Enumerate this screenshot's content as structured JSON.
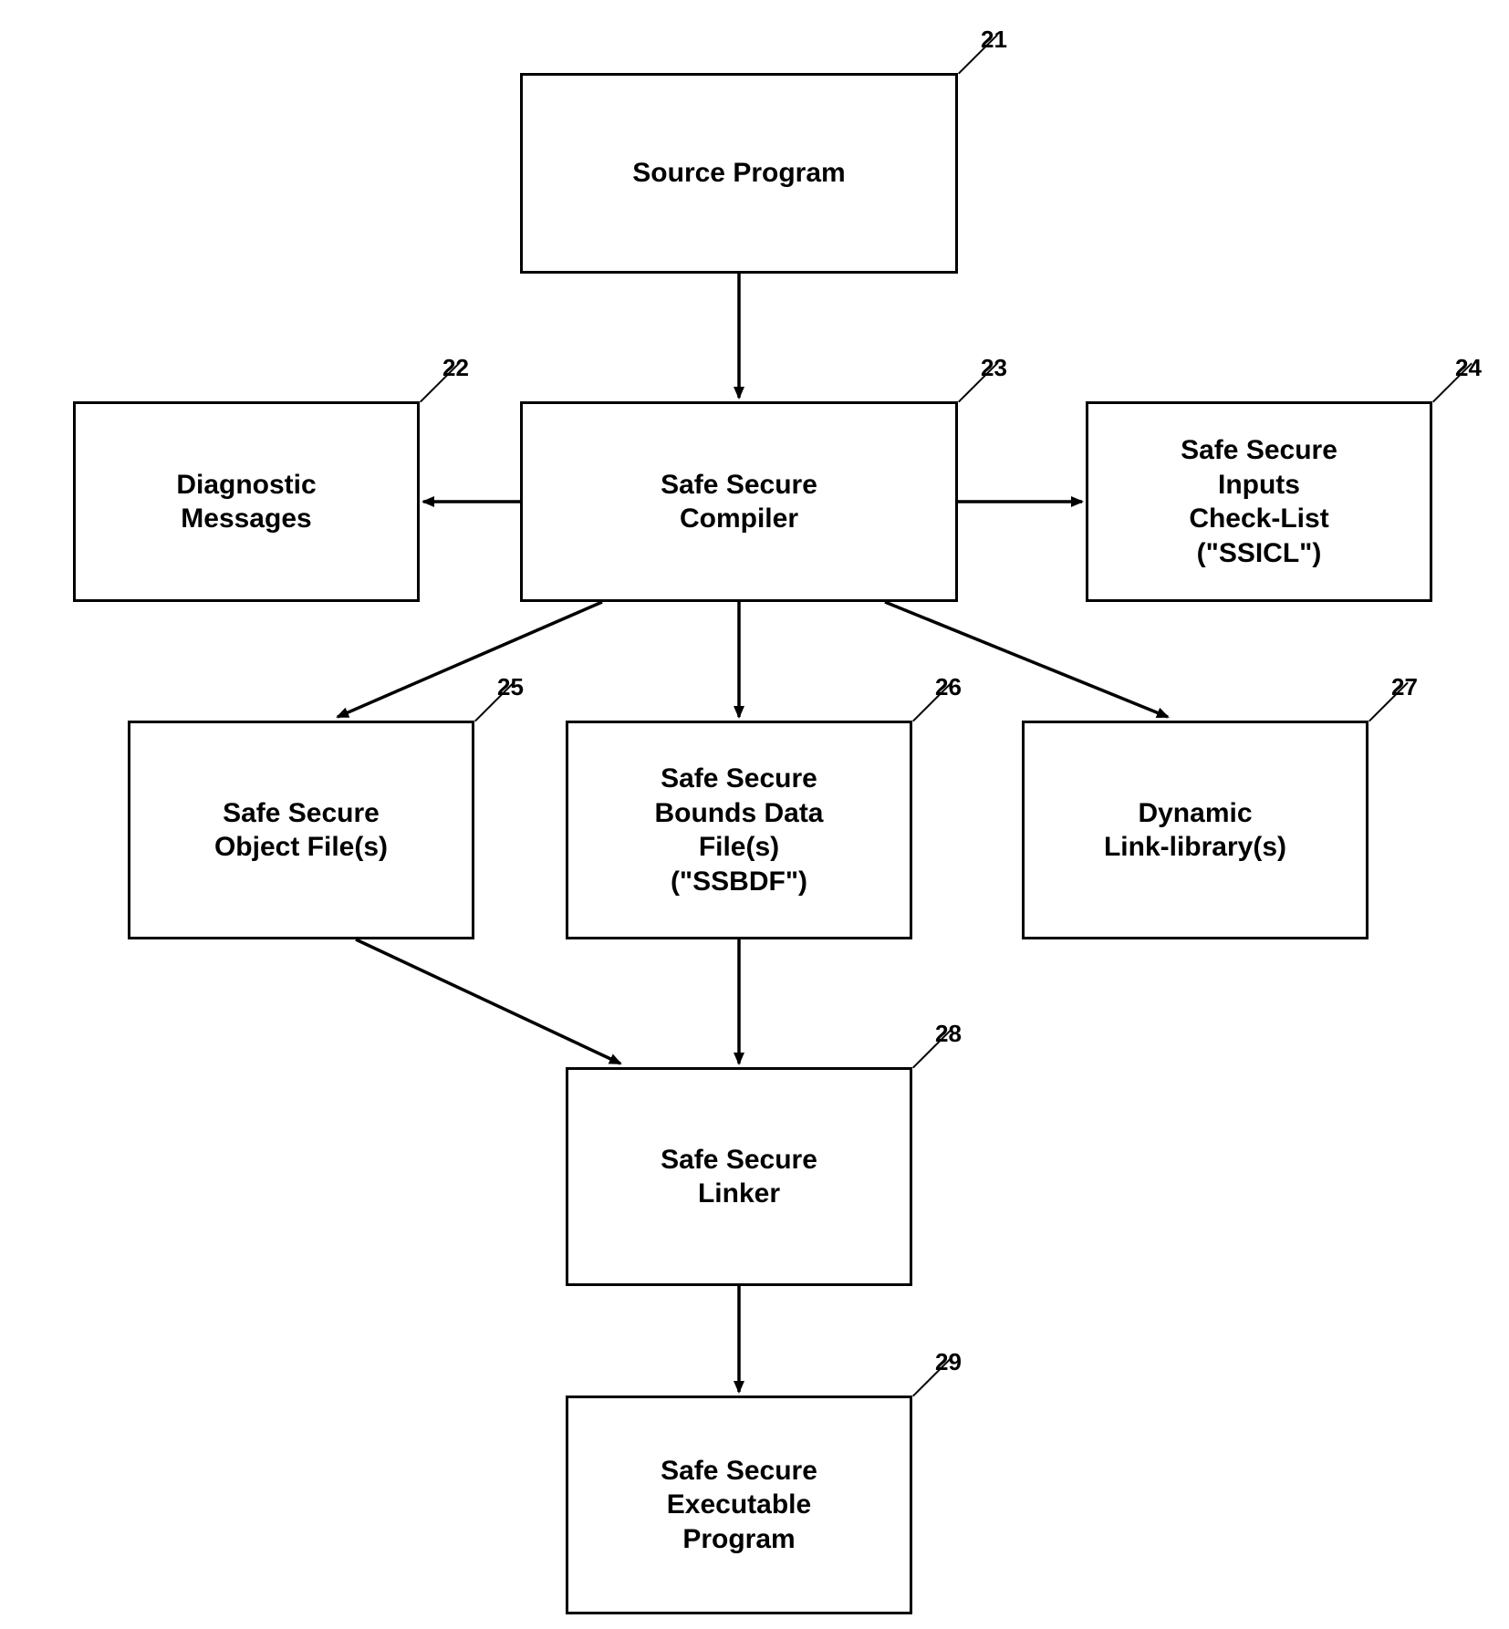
{
  "nodes": {
    "n21": {
      "ref": "21",
      "label": "Source Program"
    },
    "n22": {
      "ref": "22",
      "label": "Diagnostic\nMessages"
    },
    "n23": {
      "ref": "23",
      "label": "Safe Secure\nCompiler"
    },
    "n24": {
      "ref": "24",
      "label": "Safe Secure\nInputs\nCheck-List\n(\"SSICL\")"
    },
    "n25": {
      "ref": "25",
      "label": "Safe Secure\nObject File(s)"
    },
    "n26": {
      "ref": "26",
      "label": "Safe Secure\nBounds Data\nFile(s)\n(\"SSBDF\")"
    },
    "n27": {
      "ref": "27",
      "label": "Dynamic\nLink-library(s)"
    },
    "n28": {
      "ref": "28",
      "label": "Safe Secure\nLinker"
    },
    "n29": {
      "ref": "29",
      "label": "Safe Secure\nExecutable\nProgram"
    }
  },
  "edges": [
    {
      "from": "n21",
      "to": "n23"
    },
    {
      "from": "n23",
      "to": "n22"
    },
    {
      "from": "n23",
      "to": "n24"
    },
    {
      "from": "n23",
      "to": "n25"
    },
    {
      "from": "n23",
      "to": "n26"
    },
    {
      "from": "n23",
      "to": "n27"
    },
    {
      "from": "n25",
      "to": "n28"
    },
    {
      "from": "n26",
      "to": "n28"
    },
    {
      "from": "n28",
      "to": "n29"
    }
  ]
}
